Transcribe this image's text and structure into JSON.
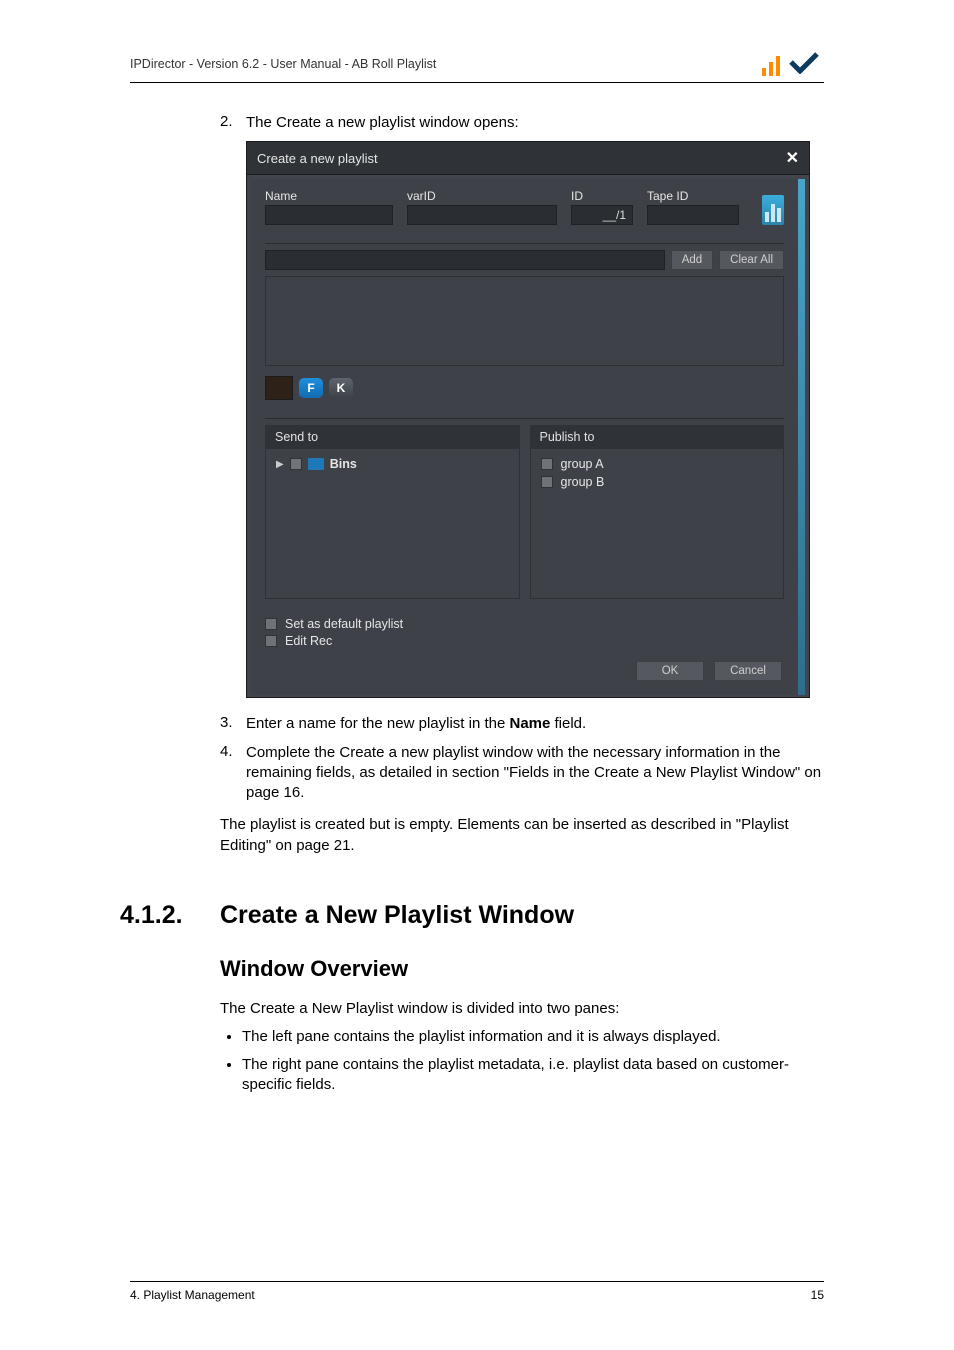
{
  "header": "IPDirector - Version 6.2 - User Manual - AB Roll Playlist",
  "steps": {
    "s2": {
      "num": "2.",
      "text": "The Create a new playlist window opens:"
    },
    "s3": {
      "num": "3.",
      "text_pre": "Enter a name for the new playlist in the ",
      "bold": "Name",
      "text_post": " field."
    },
    "s4": {
      "num": "4.",
      "text": "Complete the Create a new playlist window with the necessary information in the remaining fields, as detailed in section \"Fields in the Create a New Playlist Window\" on page 16."
    }
  },
  "after": "The playlist is created but is empty. Elements can be inserted as described in \"Playlist Editing\" on page 21.",
  "section": {
    "num": "4.1.2.",
    "title": "Create a New Playlist Window"
  },
  "subsection": "Window Overview",
  "intro": "The Create a New Playlist window is divided into two panes:",
  "bullets": [
    "The left pane contains the playlist information and it is always displayed.",
    "The right pane contains the playlist metadata, i.e. playlist data based on customer-specific fields."
  ],
  "footer": {
    "left": "4. Playlist Management",
    "right": "15"
  },
  "dialog": {
    "title": "Create a new playlist",
    "fields": {
      "name_label": "Name",
      "name_value": "",
      "varid_label": "varID",
      "varid_value": "",
      "id_label": "ID",
      "id_value": "__/1",
      "tape_label": "Tape ID",
      "tape_value": ""
    },
    "add_btn": "Add",
    "clear_btn": "Clear All",
    "badge_f": "F",
    "badge_k": "K",
    "send_to": "Send to",
    "publish_to": "Publish to",
    "bins": "Bins",
    "group_a": "group A",
    "group_b": "group B",
    "set_default": "Set as default playlist",
    "edit_rec": "Edit Rec",
    "ok": "OK",
    "cancel": "Cancel"
  }
}
